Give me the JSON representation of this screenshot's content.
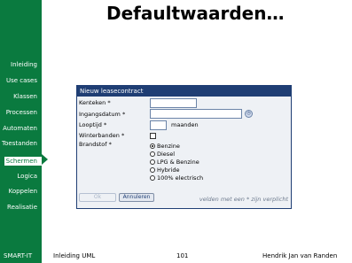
{
  "title": "Defaultwaarden…",
  "nav": [
    {
      "label": "Inleiding"
    },
    {
      "label": "Use cases"
    },
    {
      "label": "Klassen"
    },
    {
      "label": "Processen"
    },
    {
      "label": "Automaten"
    },
    {
      "label": "Toestanden"
    },
    {
      "label": "Schermen",
      "active": true
    },
    {
      "label": "Logica"
    },
    {
      "label": "Koppelen"
    },
    {
      "label": "Realisatie"
    }
  ],
  "dialog": {
    "title": "Nieuw leasecontract",
    "fields": {
      "kenteken": "Kenteken *",
      "ingangsdatum": "Ingangsdatum *",
      "looptijd": "Looptijd *",
      "looptijd_unit": "maanden",
      "winterbanden": "Winterbanden *",
      "brandstof": "Brandstof *"
    },
    "brandstof_options": [
      "Benzine",
      "Diesel",
      "LPG & Benzine",
      "Hybride",
      "100% electrisch"
    ],
    "brandstof_selected": "Benzine",
    "buttons": {
      "ok": "Ok",
      "cancel": "Annuleren"
    },
    "hint": "velden met een * zijn verplicht"
  },
  "footer": {
    "brand": "SMART-IT",
    "course": "Inleiding UML",
    "page": "101",
    "author": "Hendrik Jan van Randen"
  },
  "colors": {
    "sidebar": "#0a7a3f",
    "dialog_header": "#1f3e74"
  }
}
